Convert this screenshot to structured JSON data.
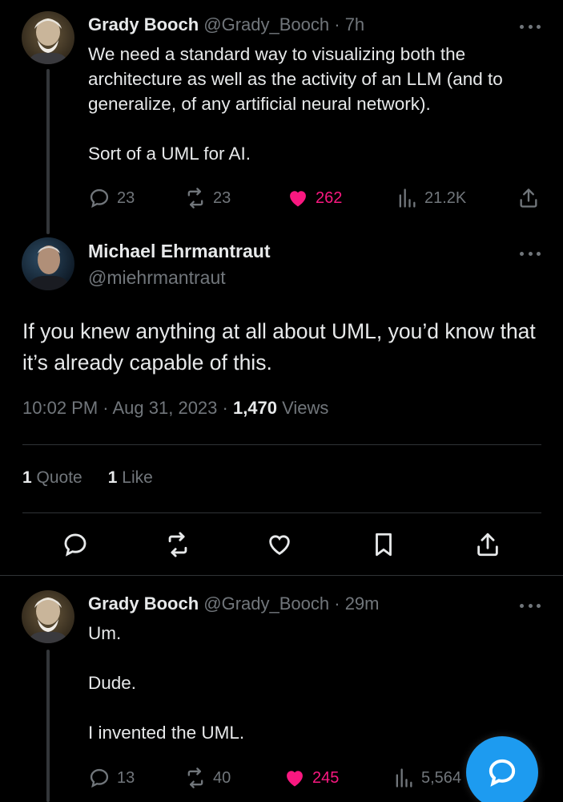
{
  "tweet1": {
    "name": "Grady Booch",
    "handle": "@Grady_Booch",
    "time": "· 7h",
    "text_p1": "We need a standard way to visualizing both the architecture as well as the activity of an LLM (and to generalize, of any artificial neural network).",
    "text_p2": "Sort of a UML for AI.",
    "replies": "23",
    "reposts": "23",
    "likes": "262",
    "views": "21.2K"
  },
  "main": {
    "name": "Michael Ehrmantraut",
    "handle": "@miehrmantraut",
    "text": "If you knew anything at all about UML, you’d know that it’s already capable of this.",
    "time": "10:02 PM · Aug 31, 2023 · ",
    "views_count": "1,470",
    "views_label": " Views",
    "quotes_count": "1",
    "quotes_label": "Quote",
    "likes_count": "1",
    "likes_label": "Like"
  },
  "tweet2": {
    "name": "Grady Booch",
    "handle": "@Grady_Booch",
    "time": "· 29m",
    "line1": "Um.",
    "line2": "Dude.",
    "line3": "I invented the UML.",
    "replies": "13",
    "reposts": "40",
    "likes": "245",
    "views": "5,564"
  },
  "colors": {
    "background": "#000000",
    "text": "#e7e9ea",
    "muted": "#71767b",
    "like": "#f91880",
    "accent": "#1d9bf0"
  },
  "icons": [
    "reply-icon",
    "repost-icon",
    "heart-icon",
    "views-icon",
    "share-icon",
    "bookmark-icon",
    "more-icon",
    "compose-reply-icon"
  ]
}
